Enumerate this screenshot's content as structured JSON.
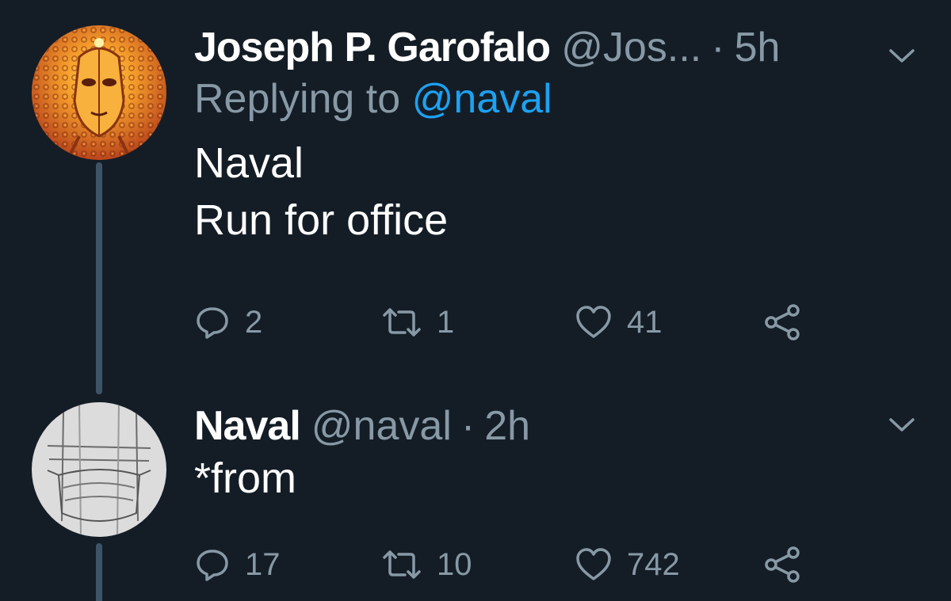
{
  "tweets": [
    {
      "name": "Joseph P. Garofalo",
      "handle": "@Jos...",
      "separator": "·",
      "time": "5h",
      "replying_prefix": "Replying to",
      "replying_to": "@naval",
      "text_lines": [
        "Naval",
        "Run for office"
      ],
      "reply_count": "2",
      "retweet_count": "1",
      "like_count": "41",
      "avatar_icon": "psychedelic-face-avatar"
    },
    {
      "name": "Naval",
      "handle": "@naval",
      "separator": "·",
      "time": "2h",
      "text_lines": [
        "*from"
      ],
      "reply_count": "17",
      "retweet_count": "10",
      "like_count": "742",
      "avatar_icon": "sketched-face-mask-avatar"
    }
  ],
  "icons": {
    "reply": "reply-icon",
    "retweet": "retweet-icon",
    "like": "heart-icon",
    "share": "share-icon",
    "menu": "chevron-down-icon"
  },
  "colors": {
    "background": "#141d26",
    "secondary_text": "#8899a6",
    "link": "#1da1f2",
    "thread_line": "#3d5466"
  }
}
